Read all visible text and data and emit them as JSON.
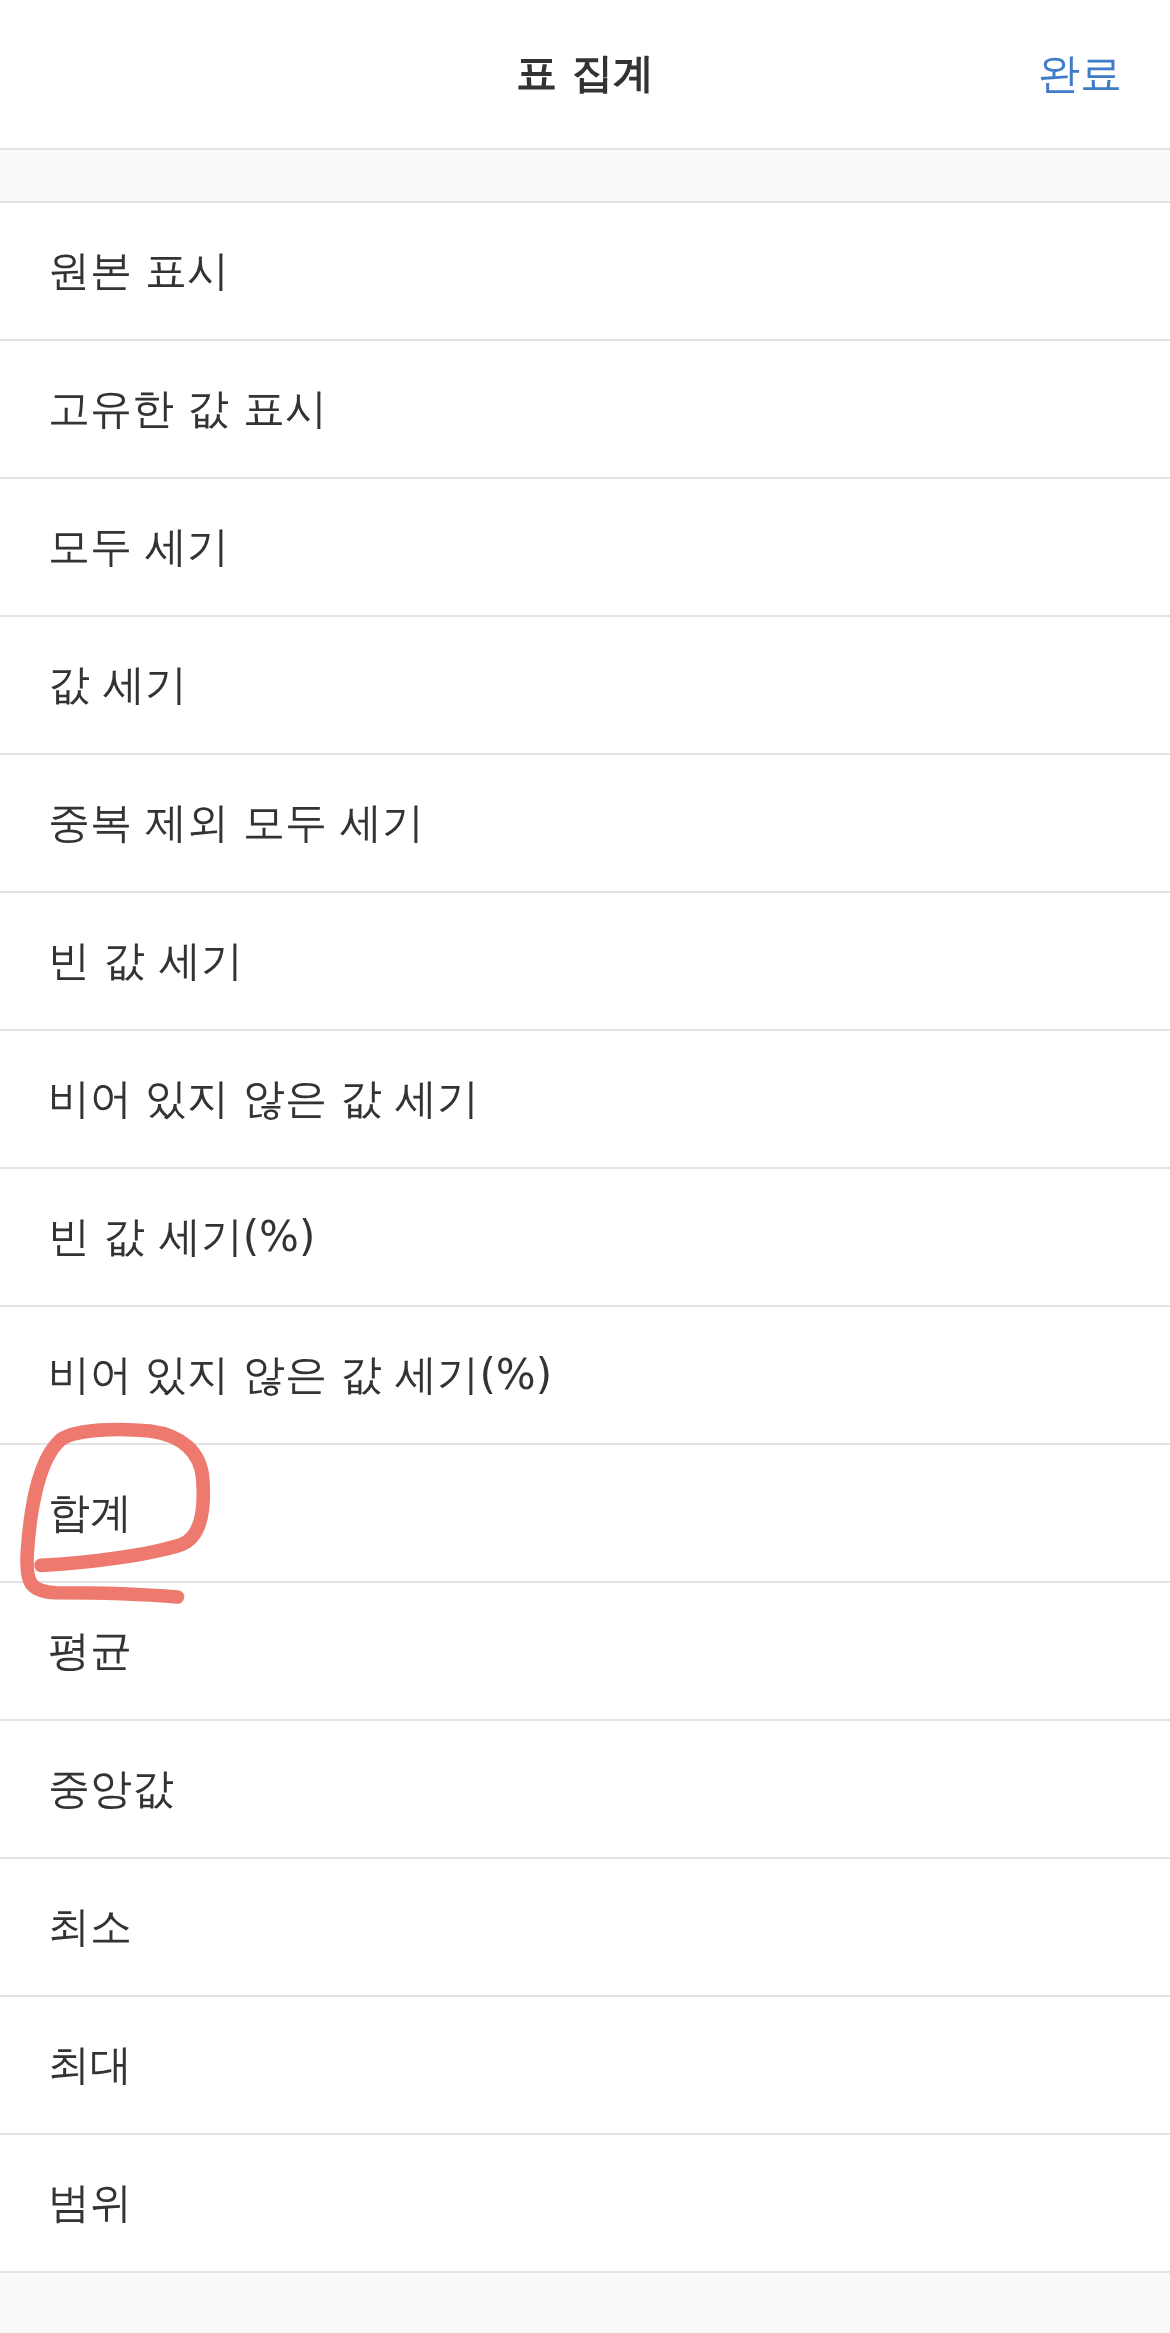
{
  "header": {
    "title": "표 집계",
    "done_button": "완료"
  },
  "items": [
    {
      "label": "원본 표시",
      "circled": false
    },
    {
      "label": "고유한 값 표시",
      "circled": false
    },
    {
      "label": "모두 세기",
      "circled": false
    },
    {
      "label": "값 세기",
      "circled": false
    },
    {
      "label": "중복 제외 모두 세기",
      "circled": false
    },
    {
      "label": "빈 값 세기",
      "circled": false
    },
    {
      "label": "비어 있지 않은 값 세기",
      "circled": false
    },
    {
      "label": "빈 값 세기(%)",
      "circled": false
    },
    {
      "label": "비어 있지 않은 값 세기(%)",
      "circled": false
    },
    {
      "label": "합계",
      "circled": true
    },
    {
      "label": "평균",
      "circled": false
    },
    {
      "label": "중앙값",
      "circled": false
    },
    {
      "label": "최소",
      "circled": false
    },
    {
      "label": "최대",
      "circled": false
    },
    {
      "label": "범위",
      "circled": false
    }
  ]
}
